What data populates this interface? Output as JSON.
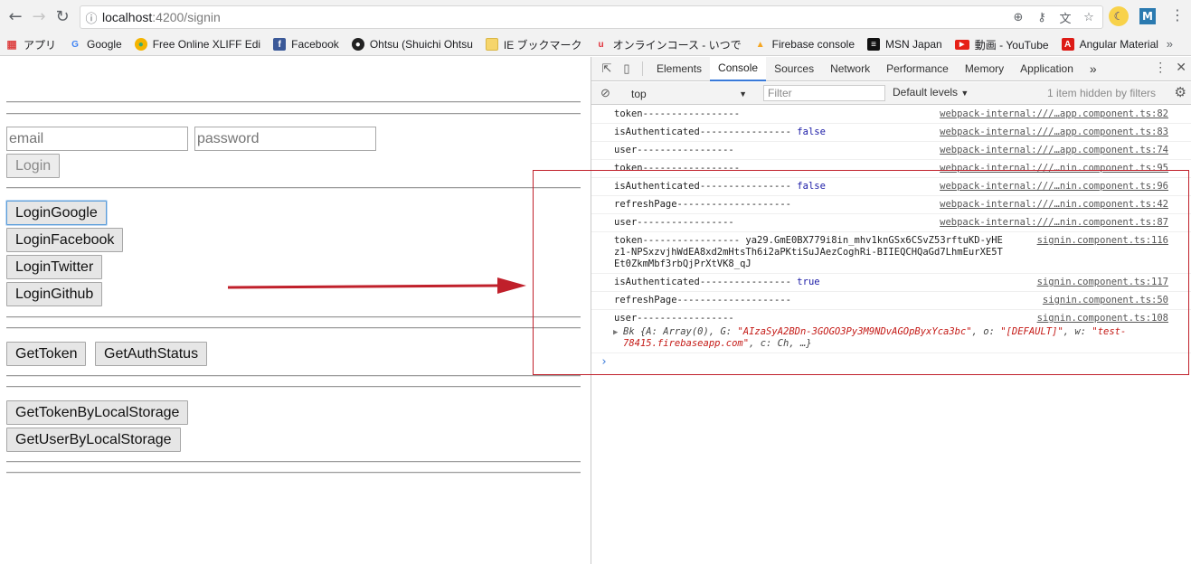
{
  "browser": {
    "url_host": "localhost",
    "url_path": ":4200/signin"
  },
  "bookmarks": [
    {
      "label": "アプリ",
      "icon": "apps-grid-icon"
    },
    {
      "label": "Google",
      "icon": "google-icon"
    },
    {
      "label": "Free Online XLIFF Edi",
      "icon": "xliff-icon"
    },
    {
      "label": "Facebook",
      "icon": "facebook-icon"
    },
    {
      "label": "Ohtsu (Shuichi Ohtsu",
      "icon": "github-icon"
    },
    {
      "label": "IE ブックマーク",
      "icon": "folder-icon"
    },
    {
      "label": "オンラインコース - いつで",
      "icon": "udemy-icon"
    },
    {
      "label": "Firebase console",
      "icon": "firebase-icon"
    },
    {
      "label": "MSN Japan",
      "icon": "msn-icon"
    },
    {
      "label": "動画 - YouTube",
      "icon": "youtube-icon"
    },
    {
      "label": "Angular Material",
      "icon": "angular-icon"
    }
  ],
  "page": {
    "email_placeholder": "email",
    "password_placeholder": "password",
    "login": "Login",
    "login_google": "LoginGoogle",
    "login_facebook": "LoginFacebook",
    "login_twitter": "LoginTwitter",
    "login_github": "LoginGithub",
    "get_token": "GetToken",
    "get_auth_status": "GetAuthStatus",
    "get_token_ls": "GetTokenByLocalStorage",
    "get_user_ls": "GetUserByLocalStorage"
  },
  "devtools": {
    "tabs": [
      "Elements",
      "Console",
      "Sources",
      "Network",
      "Performance",
      "Memory",
      "Application"
    ],
    "active_tab": "Console",
    "context": "top",
    "filter_placeholder": "Filter",
    "levels": "Default levels",
    "hidden_note": "1 item hidden by filters",
    "console_rows": [
      {
        "msg": "token-----------------",
        "val": "",
        "src": "webpack-internal:///…app.component.ts:82"
      },
      {
        "msg": "isAuthenticated---------------- ",
        "val": "false",
        "src": "webpack-internal:///…app.component.ts:83"
      },
      {
        "msg": "user-----------------",
        "val": "",
        "src": "webpack-internal:///…app.component.ts:74"
      },
      {
        "msg": "token-----------------",
        "val": "",
        "src": "webpack-internal:///…nin.component.ts:95"
      },
      {
        "msg": "isAuthenticated---------------- ",
        "val": "false",
        "src": "webpack-internal:///…nin.component.ts:96"
      },
      {
        "msg": "refreshPage--------------------",
        "val": "",
        "src": "webpack-internal:///…nin.component.ts:42"
      },
      {
        "msg": "user-----------------",
        "val": "",
        "src": "webpack-internal:///…nin.component.ts:87"
      },
      {
        "msg": "token----------------- ya29.GmE0BX779i8in_mhv1knGSx6CSvZ53rftuKD-yHEz1-NPSxzvjhWdEA8xd2mHtsTh6i2aPKtiSuJAezCoghRi-BIIEQCHQaGd7LhmEurXE5TEt0ZkmMbf3rbQjPrXtVK8_qJ",
        "val": "",
        "src": "signin.component.ts:116"
      },
      {
        "msg": "isAuthenticated---------------- ",
        "val": "true",
        "src": "signin.component.ts:117"
      },
      {
        "msg": "refreshPage--------------------",
        "val": "",
        "src": "signin.component.ts:50"
      },
      {
        "msg": "user-----------------",
        "val": "",
        "src": "signin.component.ts:108"
      }
    ],
    "object_preview": {
      "prefix": "Bk {A: Array(0), G: ",
      "g_value": "\"AIzaSyA2BDn-3GOGO3Py3M9NDvAGOpByxYca3bc\"",
      "mid": ", o: ",
      "o_value": "\"[DEFAULT]\"",
      "mid2": ", w: ",
      "w_value": "\"test-78415.firebaseapp.com\"",
      "suffix": ", c: Ch, …}"
    }
  },
  "colors": {
    "annotation": "#c0202b",
    "accent": "#3879d9"
  }
}
